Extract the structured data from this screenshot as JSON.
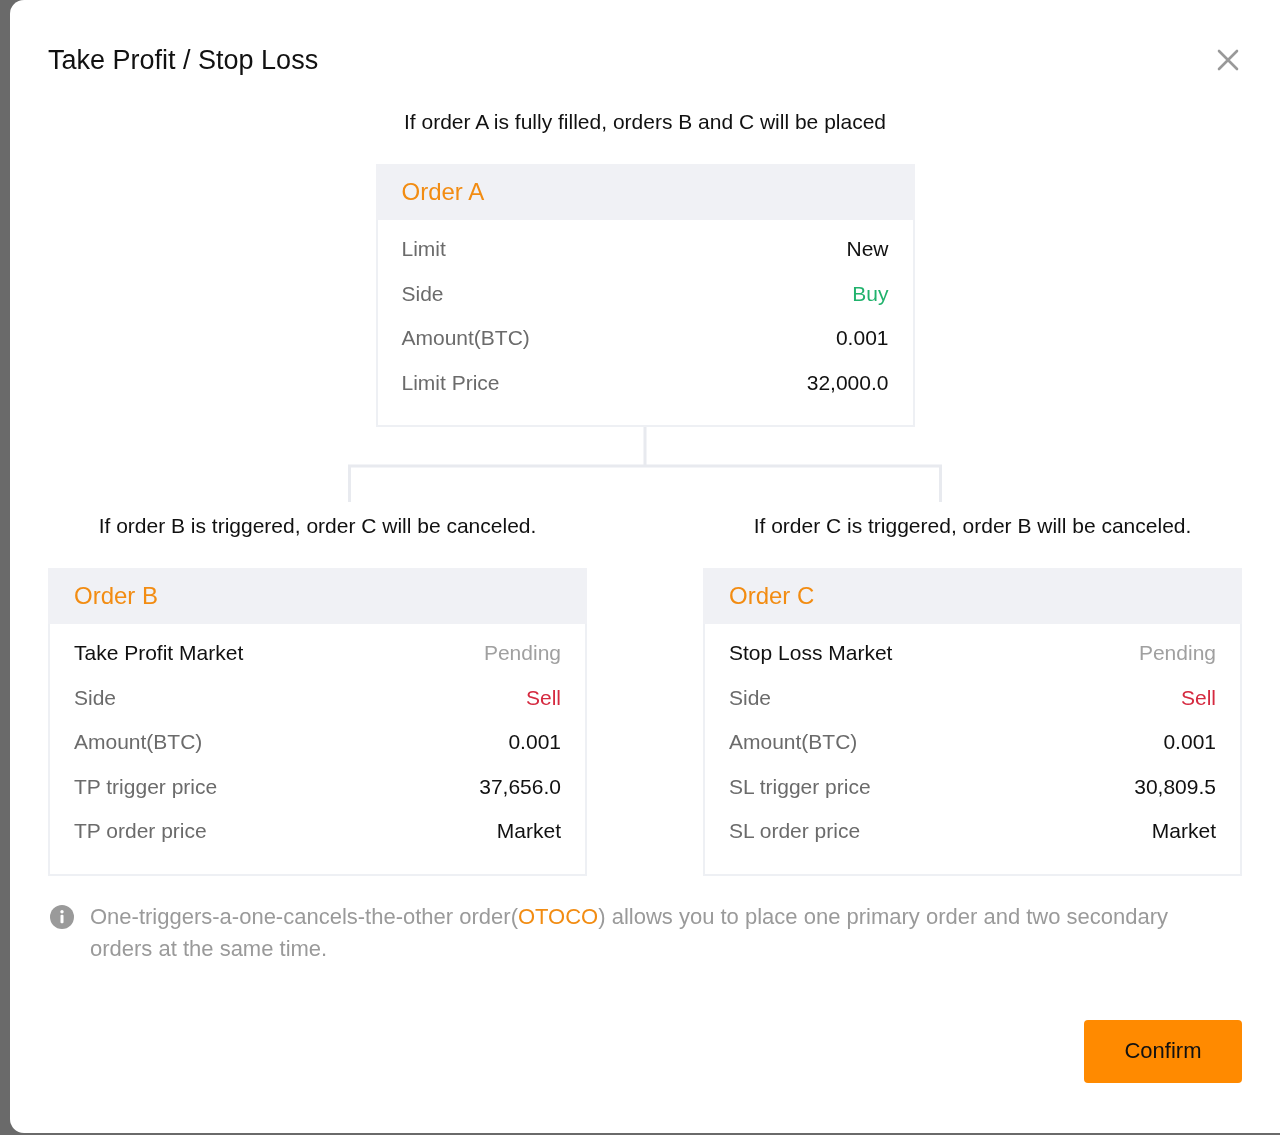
{
  "dialog": {
    "title": "Take Profit / Stop Loss"
  },
  "intro": "If order A is fully filled, orders B and C will be placed",
  "primary_order": {
    "title": "Order A",
    "rows": [
      {
        "kind": "plain",
        "label": "Limit",
        "value": "New"
      },
      {
        "kind": "side",
        "label": "Side",
        "value": "Buy",
        "color": "#20b26c"
      },
      {
        "kind": "plain",
        "label": "Amount(BTC)",
        "value": "0.001"
      },
      {
        "kind": "plain",
        "label": "Limit Price",
        "value": "32,000.0"
      }
    ]
  },
  "branches": [
    {
      "caption": "If order B is triggered, order C will be canceled.",
      "order": {
        "title": "Order B",
        "rows": [
          {
            "kind": "title",
            "label": "Take Profit Market",
            "value": "Pending"
          },
          {
            "kind": "side",
            "label": "Side",
            "value": "Sell",
            "color": "#d5293f"
          },
          {
            "kind": "plain",
            "label": "Amount(BTC)",
            "value": "0.001"
          },
          {
            "kind": "plain",
            "label": "TP trigger price",
            "value": "37,656.0"
          },
          {
            "kind": "plain",
            "label": "TP order price",
            "value": "Market"
          }
        ]
      }
    },
    {
      "caption": "If order C is triggered, order B will be canceled.",
      "order": {
        "title": "Order C",
        "rows": [
          {
            "kind": "title",
            "label": "Stop Loss Market",
            "value": "Pending"
          },
          {
            "kind": "side",
            "label": "Side",
            "value": "Sell",
            "color": "#d5293f"
          },
          {
            "kind": "plain",
            "label": "Amount(BTC)",
            "value": "0.001"
          },
          {
            "kind": "plain",
            "label": "SL trigger price",
            "value": "30,809.5"
          },
          {
            "kind": "plain",
            "label": "SL order price",
            "value": "Market"
          }
        ]
      }
    }
  ],
  "note": {
    "before": "One-triggers-a-one-cancels-the-other order(",
    "highlight": "OTOCO",
    "after": ") allows you to place one primary order and two secondary orders at the same time."
  },
  "confirm_button": {
    "label": "Confirm"
  }
}
